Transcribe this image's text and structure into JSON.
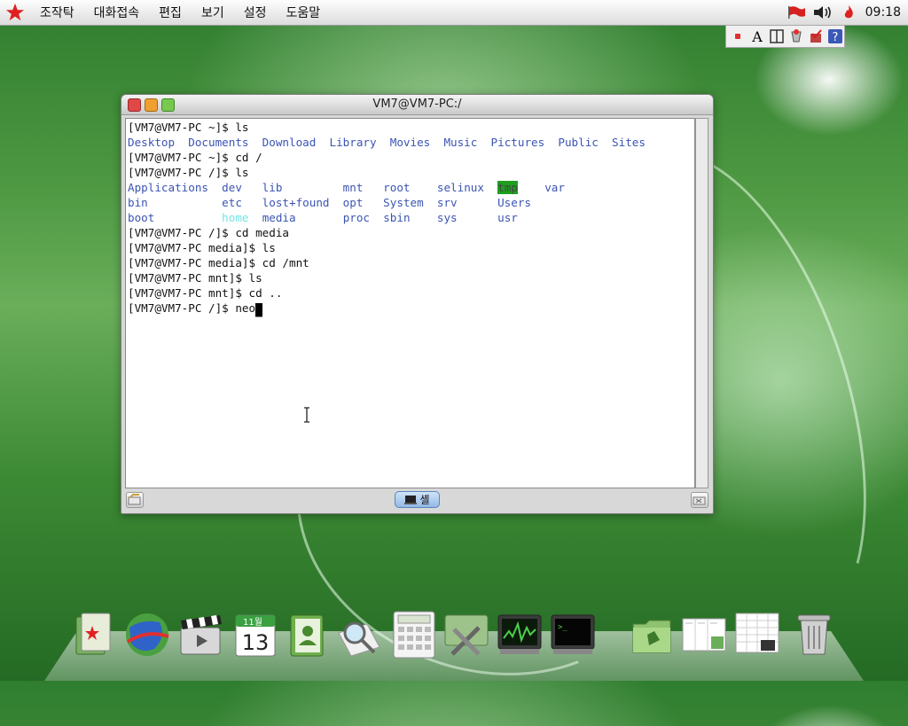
{
  "menubar": {
    "items": [
      "조작탁",
      "대화접속",
      "편집",
      "보기",
      "설정",
      "도움말"
    ],
    "clock": "09:18"
  },
  "window": {
    "title": "VM7@VM7-PC:/",
    "shell_tab_label": "셸"
  },
  "terminal": {
    "lines": [
      {
        "prompt": "[VM7@VM7-PC ~]$ ",
        "cmd": "ls"
      },
      {
        "listing": [
          "Desktop",
          "Documents",
          "Download",
          "Library",
          "Movies",
          "Music",
          "Pictures",
          "Public",
          "Sites"
        ]
      },
      {
        "prompt": "[VM7@VM7-PC ~]$ ",
        "cmd": "cd /"
      },
      {
        "prompt": "[VM7@VM7-PC /]$ ",
        "cmd": "ls"
      },
      {
        "grid": [
          [
            "Applications",
            "dev",
            "lib",
            "mnt",
            "root",
            "selinux",
            "tmp",
            "var"
          ],
          [
            "bin",
            "etc",
            "lost+found",
            "opt",
            "System",
            "srv",
            "Users"
          ],
          [
            "boot",
            "home",
            "media",
            "proc",
            "sbin",
            "sys",
            "usr"
          ]
        ]
      },
      {
        "prompt": "[VM7@VM7-PC /]$ ",
        "cmd": "cd media"
      },
      {
        "prompt": "[VM7@VM7-PC media]$ ",
        "cmd": "ls"
      },
      {
        "prompt": "[VM7@VM7-PC media]$ ",
        "cmd": "cd /mnt"
      },
      {
        "prompt": "[VM7@VM7-PC mnt]$ ",
        "cmd": "ls"
      },
      {
        "prompt": "[VM7@VM7-PC mnt]$ ",
        "cmd": "cd .."
      },
      {
        "prompt": "[VM7@VM7-PC /]$ ",
        "cmd": "neo"
      }
    ]
  },
  "calendar": {
    "month": "11월",
    "day": "13"
  },
  "colors": {
    "dir_blue": "#3b54b4",
    "highlight_green": "#1f9e1f",
    "home_cyan": "#75e3e3",
    "star_red": "#e02020"
  }
}
